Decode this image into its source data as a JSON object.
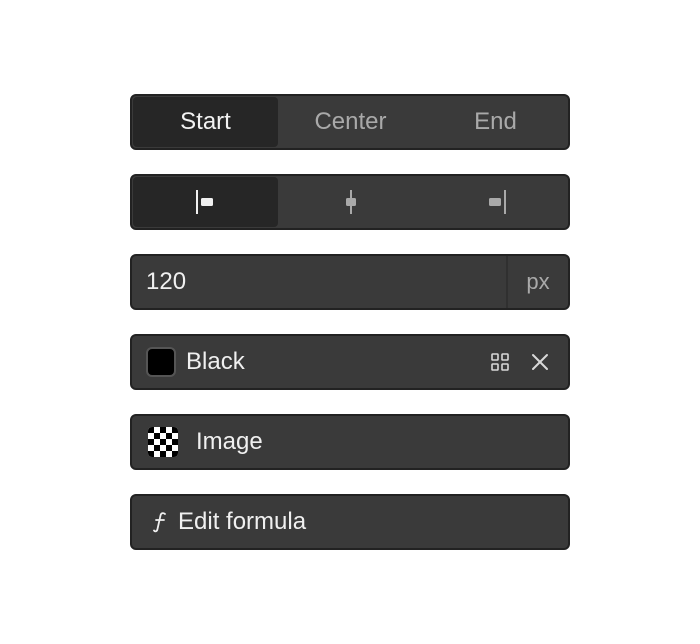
{
  "text_align": {
    "options": [
      {
        "label": "Start",
        "active": true
      },
      {
        "label": "Center",
        "active": false
      },
      {
        "label": "End",
        "active": false
      }
    ]
  },
  "icon_align": {
    "options": [
      {
        "icon": "align-start-icon",
        "active": true
      },
      {
        "icon": "align-center-icon",
        "active": false
      },
      {
        "icon": "align-end-icon",
        "active": false
      }
    ]
  },
  "size_input": {
    "value": "120",
    "unit": "px"
  },
  "color": {
    "label": "Black",
    "swatch_color": "#000000",
    "icons": [
      "grid-icon",
      "close-icon"
    ]
  },
  "image": {
    "label": "Image",
    "icon": "checkerboard-icon"
  },
  "formula": {
    "label": "Edit formula",
    "icon": "function-icon"
  },
  "colors": {
    "panel_bg": "#3a3a3a",
    "panel_border": "#222222",
    "active_bg": "#262626",
    "text_active": "#f2f2f2",
    "text_muted": "#a9a9a9"
  }
}
